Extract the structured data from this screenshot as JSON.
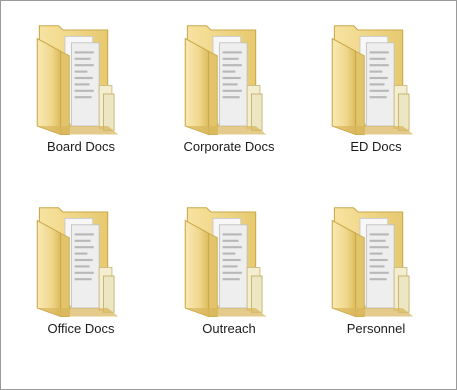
{
  "folders": [
    {
      "label": "Board Docs"
    },
    {
      "label": "Corporate Docs"
    },
    {
      "label": "ED Docs"
    },
    {
      "label": "Office Docs"
    },
    {
      "label": "Outreach"
    },
    {
      "label": "Personnel"
    }
  ],
  "icon": "folder-with-documents-icon",
  "colors": {
    "folder_light": "#f8e6a6",
    "folder_mid": "#edd27f",
    "folder_dark": "#d9b657",
    "paper": "#f5f5f5",
    "label_text": "#1b1b1b",
    "border": "#9a9a9a"
  }
}
